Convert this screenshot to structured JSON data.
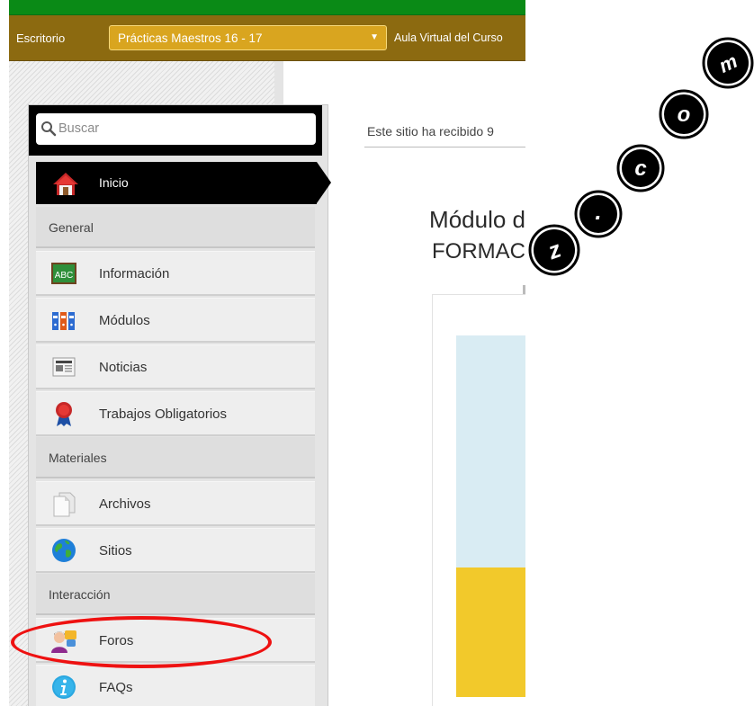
{
  "topbar": {
    "desk_label": "Escritorio",
    "site_selected": "Prácticas Maestros 16 - 17",
    "site_caret": "▼",
    "aula_label": "Aula Virtual del Curso"
  },
  "search": {
    "placeholder": "Buscar"
  },
  "menu": {
    "home": "Inicio",
    "section_general": "General",
    "informacion": "Información",
    "modulos": "Módulos",
    "noticias": "Noticias",
    "trabajos": "Trabajos Obligatorios",
    "section_materiales": "Materiales",
    "archivos": "Archivos",
    "sitios": "Sitios",
    "section_interaccion": "Interacción",
    "foros": "Foros",
    "faqs": "FAQs"
  },
  "content": {
    "visits_text": "Este sitio ha recibido 9",
    "module_title_line1": "Módulo d",
    "module_title_line2": "FORMAC"
  },
  "watermark": {
    "text": "z.com"
  },
  "colors": {
    "greenbar": "#0a8a16",
    "toolbar": "#8c6a10",
    "site_select": "#d9a51f",
    "annotation": "#e11111",
    "sky": "#d9ecf3",
    "sand": "#f2c92b"
  },
  "icons": {
    "search": "magnifier-icon",
    "home": "house-icon",
    "informacion": "abc-chalkboard-icon",
    "modulos": "binders-icon",
    "noticias": "newspaper-icon",
    "trabajos": "award-ribbon-icon",
    "archivos": "documents-icon",
    "sitios": "globe-icon",
    "foros": "user-speech-icon",
    "faqs": "info-icon"
  }
}
